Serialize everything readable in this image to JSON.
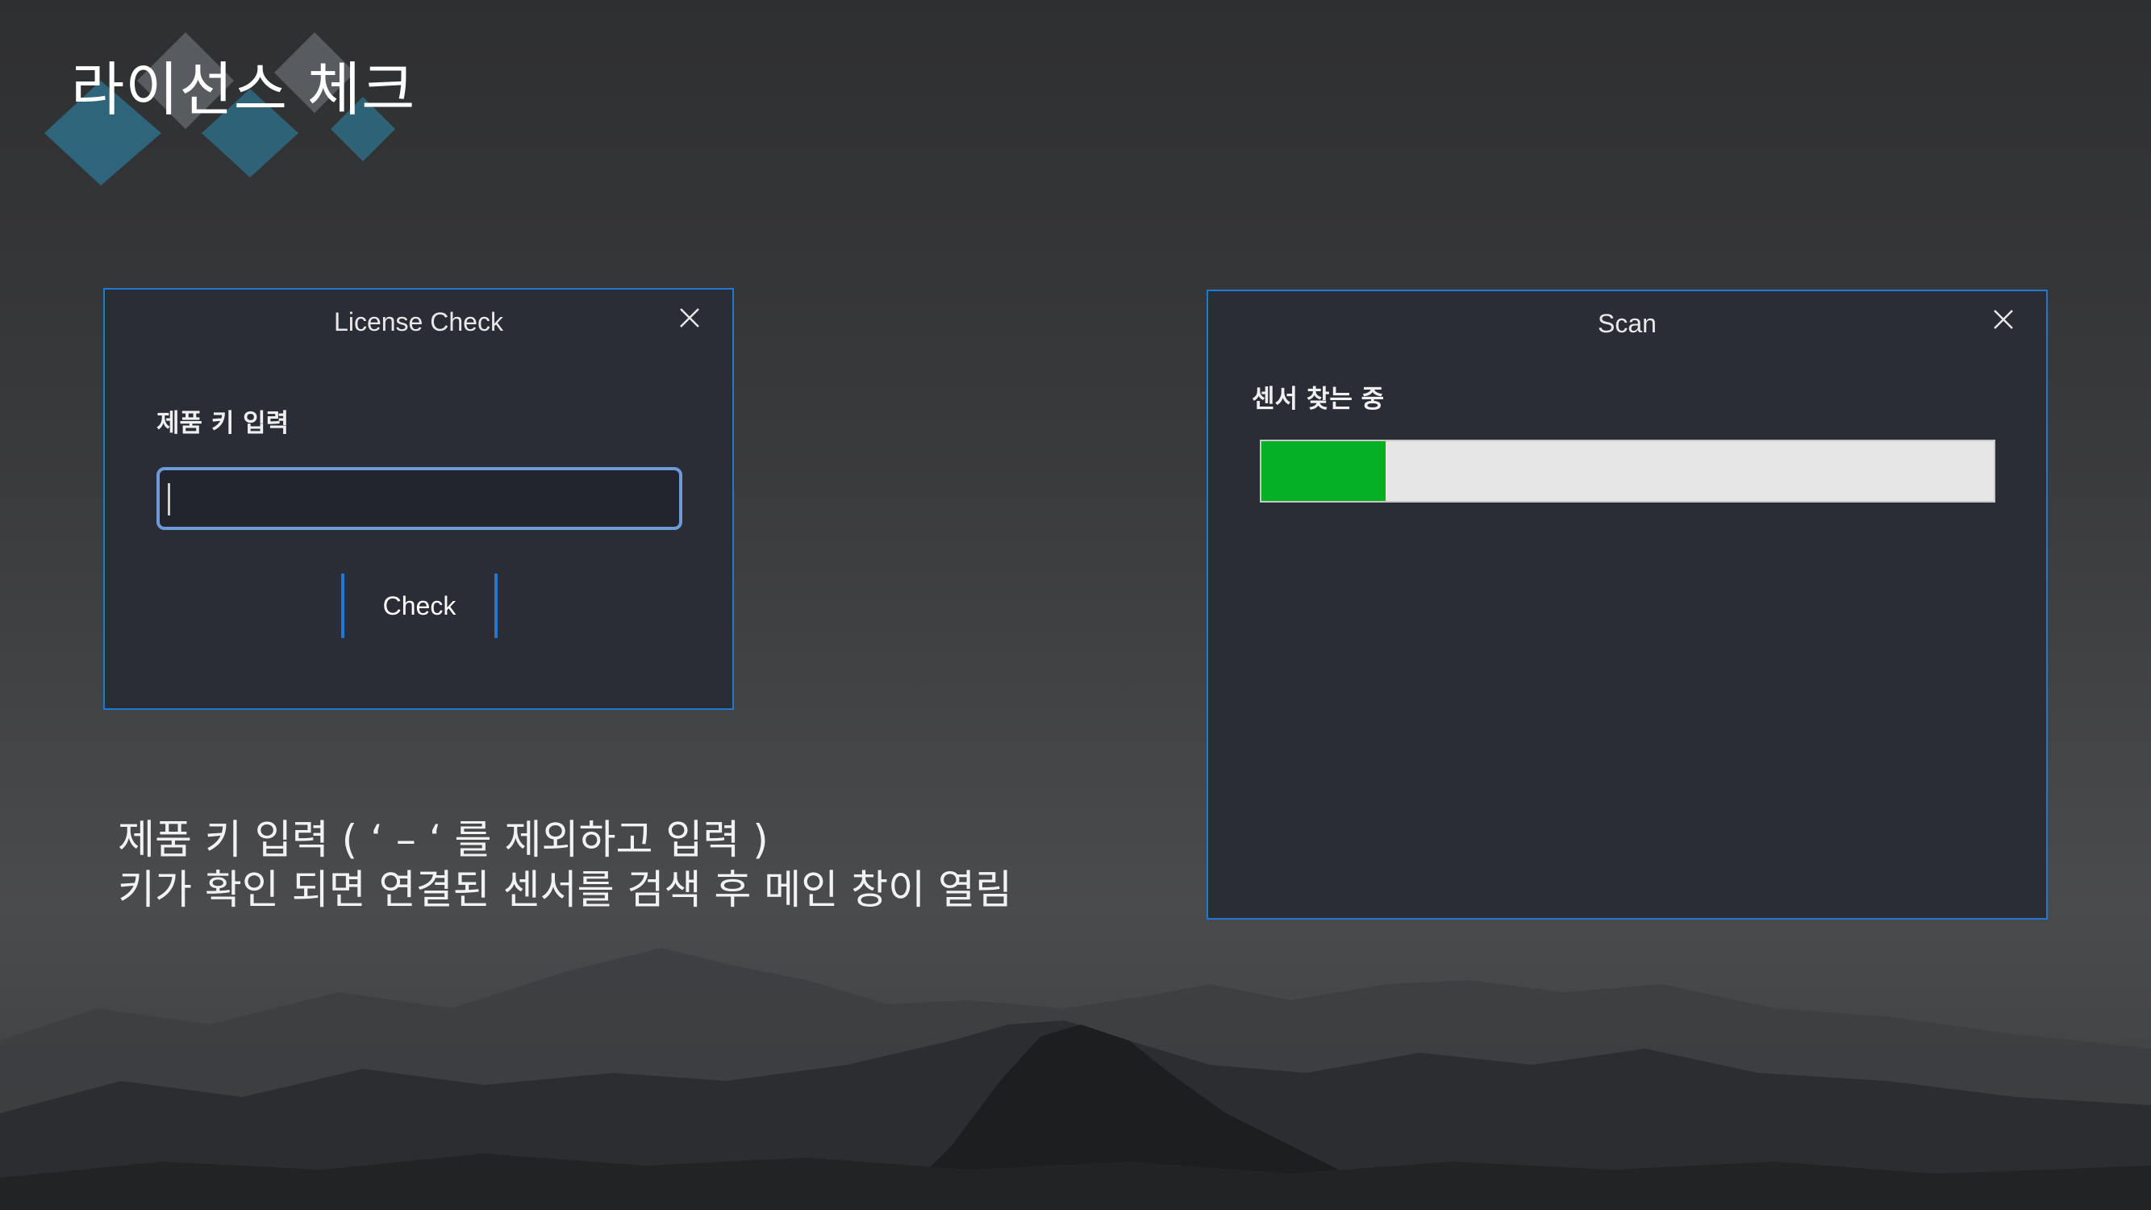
{
  "slide": {
    "title": "라이선스 체크",
    "caption_lines": [
      "제품 키 입력 ( ‘ – ‘ 를 제외하고 입력 )",
      "키가 확인 되면 연결된 센서를 검색 후 메인 창이 열림"
    ]
  },
  "license_dialog": {
    "title": "License Check",
    "close_icon": "close-icon",
    "field_label": "제품 키 입력",
    "input_value": "",
    "check_button_label": "Check"
  },
  "scan_dialog": {
    "title": "Scan",
    "close_icon": "close-icon",
    "status_text": "센서 찾는 중",
    "progress_fraction": 0.17
  },
  "colors": {
    "dialog_border": "#1f78d1",
    "dialog_bg": "#2a2c36",
    "progress_fill": "#06b025",
    "progress_track": "#e6e6e6",
    "input_border": "#6e9ad8"
  }
}
